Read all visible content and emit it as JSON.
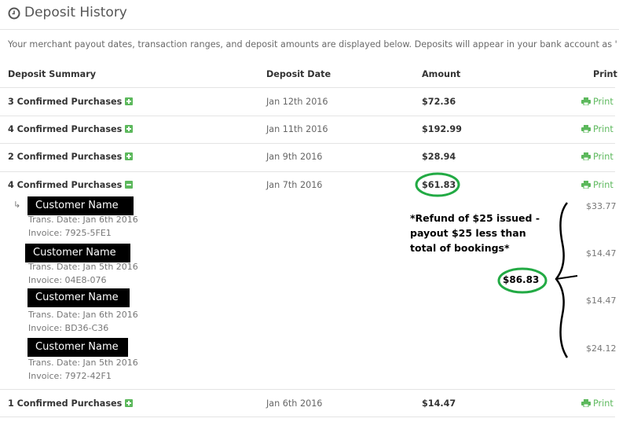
{
  "header": {
    "title": "Deposit History"
  },
  "intro": "Your merchant payout dates, transaction ranges, and deposit amounts are displayed below. Deposits will appear in your bank account as \"Propay\"",
  "columns": {
    "summary": "Deposit Summary",
    "date": "Deposit Date",
    "amount": "Amount",
    "print": "Print"
  },
  "rows": [
    {
      "summary": "3 Confirmed Purchases",
      "date": "Jan 12th 2016",
      "amount": "$72.36",
      "print": "Print",
      "expanded": false
    },
    {
      "summary": "4 Confirmed Purchases",
      "date": "Jan 11th 2016",
      "amount": "$192.99",
      "print": "Print",
      "expanded": false
    },
    {
      "summary": "2 Confirmed Purchases",
      "date": "Jan 9th 2016",
      "amount": "$28.94",
      "print": "Print",
      "expanded": false
    },
    {
      "summary": "4 Confirmed Purchases",
      "date": "Jan 7th 2016",
      "amount": "$61.83",
      "print": "Print",
      "expanded": true
    },
    {
      "summary": "1 Confirmed Purchases",
      "date": "Jan 6th 2016",
      "amount": "$14.47",
      "print": "Print",
      "expanded": false
    }
  ],
  "details": [
    {
      "customer": "Customer Name",
      "trans_date": "Trans. Date: Jan 6th 2016",
      "invoice": "Invoice: 7925-5FE1",
      "amount": "$33.77"
    },
    {
      "customer": "Customer Name",
      "trans_date": "Trans. Date: Jan 5th 2016",
      "invoice": "Invoice: 04E8-076",
      "amount": "$14.47"
    },
    {
      "customer": "Customer Name",
      "trans_date": "Trans. Date: Jan 6th 2016",
      "invoice": "Invoice: BD36-C36",
      "amount": "$14.47"
    },
    {
      "customer": "Customer Name",
      "trans_date": "Trans. Date: Jan 5th 2016",
      "invoice": "Invoice: 7972-42F1",
      "amount": "$24.12"
    }
  ],
  "annotation": {
    "note": "*Refund of $25 issued - payout $25 less than total of bookings*",
    "total": "$86.83"
  },
  "colors": {
    "accent": "#5cb85c",
    "annotation_circle": "#22aa44"
  },
  "icons": {
    "title": "clock-icon",
    "print": "printer-icon",
    "expand": "plus-icon",
    "collapse": "minus-icon",
    "child": "child-arrow-icon"
  }
}
